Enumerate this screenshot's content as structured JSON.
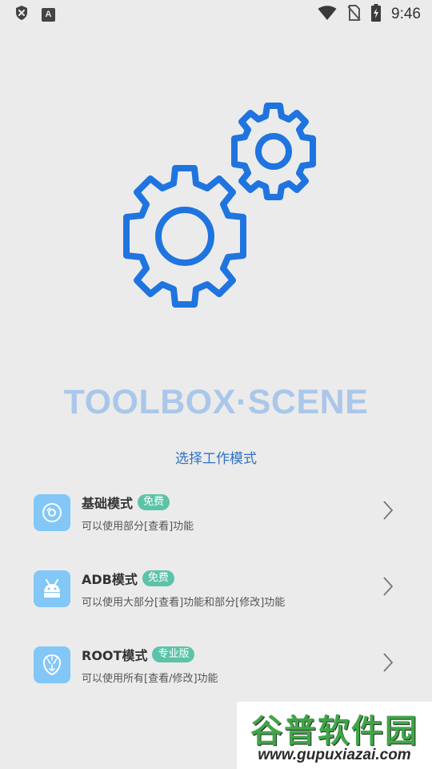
{
  "status_bar": {
    "time": "9:46",
    "icons": [
      "shield-x-icon",
      "a-notification-icon",
      "wifi-icon",
      "no-sim-icon",
      "battery-charging-icon"
    ]
  },
  "hero": {
    "brand": "TOOLBOX·SCENE",
    "subtitle": "选择工作模式"
  },
  "modes": [
    {
      "title": "基础模式",
      "badge": "免费",
      "description": "可以使用部分[查看]功能",
      "icon": "disc-icon"
    },
    {
      "title": "ADB模式",
      "badge": "免费",
      "description": "可以使用大部分[查看]功能和部分[修改]功能",
      "icon": "android-icon"
    },
    {
      "title": "ROOT模式",
      "badge": "专业版",
      "description": "可以使用所有[查看/修改]功能",
      "icon": "lion-head-icon"
    }
  ],
  "watermark": {
    "title": "谷普软件园",
    "url": "www.gupuxiazai.com"
  },
  "colors": {
    "background": "#ebebeb",
    "accent_blue": "#1f74df",
    "brand_text": "#aac7ea",
    "icon_tile": "#82c7f7",
    "badge": "#5cc3a9"
  }
}
